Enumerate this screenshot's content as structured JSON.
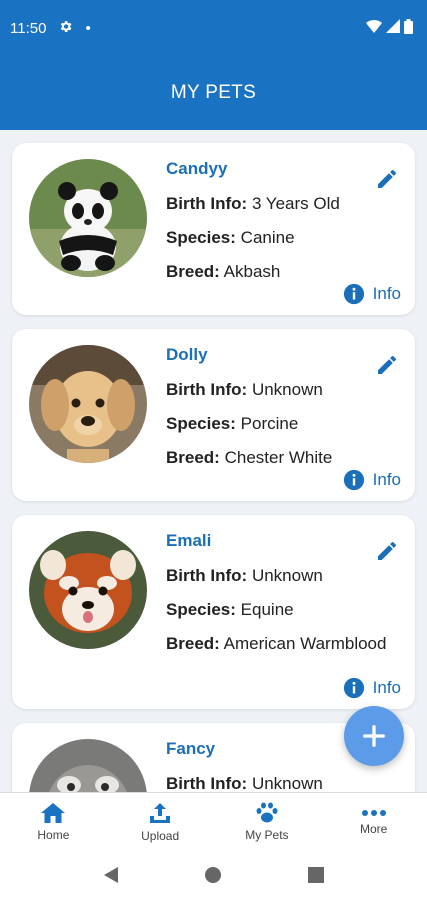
{
  "status": {
    "time": "11:50",
    "dot": "•"
  },
  "header": {
    "title": "MY PETS"
  },
  "pets": [
    {
      "name": "Candyy",
      "birth_label": "Birth Info:",
      "birth": "3 Years Old",
      "species_label": "Species:",
      "species": "Canine",
      "breed_label": "Breed:",
      "breed": "Akbash",
      "info_label": "Info"
    },
    {
      "name": "Dolly",
      "birth_label": "Birth Info:",
      "birth": "Unknown",
      "species_label": "Species:",
      "species": "Porcine",
      "breed_label": "Breed:",
      "breed": "Chester White",
      "info_label": "Info"
    },
    {
      "name": "Emali",
      "birth_label": "Birth Info:",
      "birth": "Unknown",
      "species_label": "Species:",
      "species": "Equine",
      "breed_label": "Breed:",
      "breed": "American Warmblood",
      "info_label": "Info"
    },
    {
      "name": "Fancy",
      "birth_label": "Birth Info:",
      "birth": "Unknown"
    }
  ],
  "nav": {
    "home": "Home",
    "upload": "Upload",
    "my_pets": "My Pets",
    "more": "More"
  },
  "colors": {
    "primary": "#1a73c2",
    "accent": "#1a6fb8",
    "fab": "#5b9be8"
  }
}
